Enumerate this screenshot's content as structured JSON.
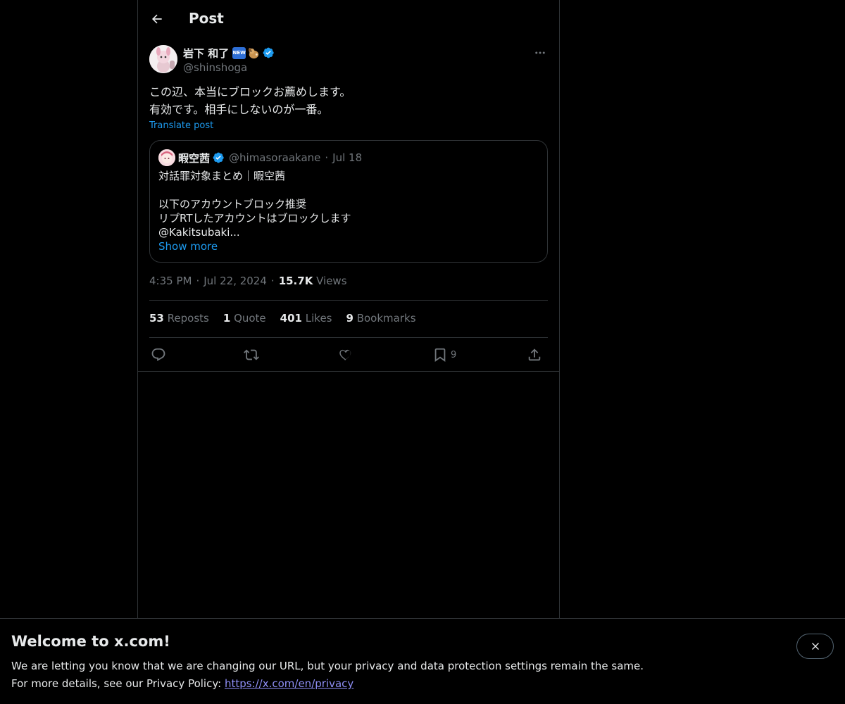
{
  "header": {
    "title": "Post"
  },
  "author": {
    "display_name": "岩下 和了",
    "new_badge": "NEW",
    "handle": "@shinshoga",
    "verified": true
  },
  "tweet": {
    "lines": [
      "この辺、本当にブロックお薦めします。",
      "有効です。相手にしないのが一番。"
    ],
    "translate_label": "Translate post"
  },
  "quote": {
    "display_name": "暇空茜",
    "handle": "@himasoraakane",
    "separator": "·",
    "date": "Jul 18",
    "lines": [
      "対話罪対象まとめ｜暇空茜",
      "",
      "以下のアカウントブロック推奨",
      "リプRTしたアカウントはブロックします",
      "@Kakitsubaki..."
    ],
    "show_more": "Show more"
  },
  "meta": {
    "time": "4:35 PM",
    "separator": "·",
    "date": "Jul 22, 2024",
    "views_count": "15.7K",
    "views_label": "Views"
  },
  "stats": {
    "reposts_count": "53",
    "reposts_label": "Reposts",
    "quote_count": "1",
    "quote_label": "Quote",
    "likes_count": "401",
    "likes_label": "Likes",
    "bookmarks_count": "9",
    "bookmarks_label": "Bookmarks"
  },
  "actions": {
    "bookmark_count": "9"
  },
  "banner": {
    "title": "Welcome to x.com!",
    "line1": "We are letting you know that we are changing our URL, but your privacy and data protection settings remain the same.",
    "line2_prefix": "For more details, see our Privacy Policy: ",
    "link": "https://x.com/en/privacy"
  },
  "colors": {
    "accent": "#1d9bf0",
    "text": "#e7e9ea",
    "muted": "#71767b",
    "border": "#2f3336",
    "background": "#000000"
  }
}
